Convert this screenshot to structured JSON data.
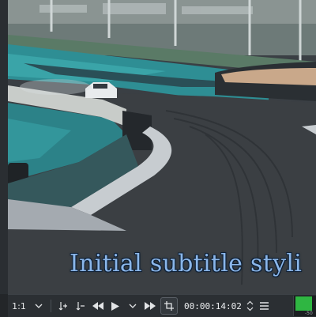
{
  "monitor": {
    "subtitle_text": "Initial subtitle styli"
  },
  "toolbar": {
    "zoom_label": "1:1",
    "timecode": "00:00:14:02"
  },
  "audio_meter": {
    "level": 0.85,
    "scale_label": "-50"
  },
  "colors": {
    "subtitle": "#8ab6ea",
    "meter": "#2fb642",
    "toolbar_bg": "#2b2f33"
  },
  "icons": [
    "chevron-down-icon",
    "zoom-in-icon",
    "zoom-out-icon",
    "rewind-icon",
    "play-icon",
    "fast-forward-icon",
    "crop-icon",
    "spinner-icon",
    "menu-icon"
  ]
}
